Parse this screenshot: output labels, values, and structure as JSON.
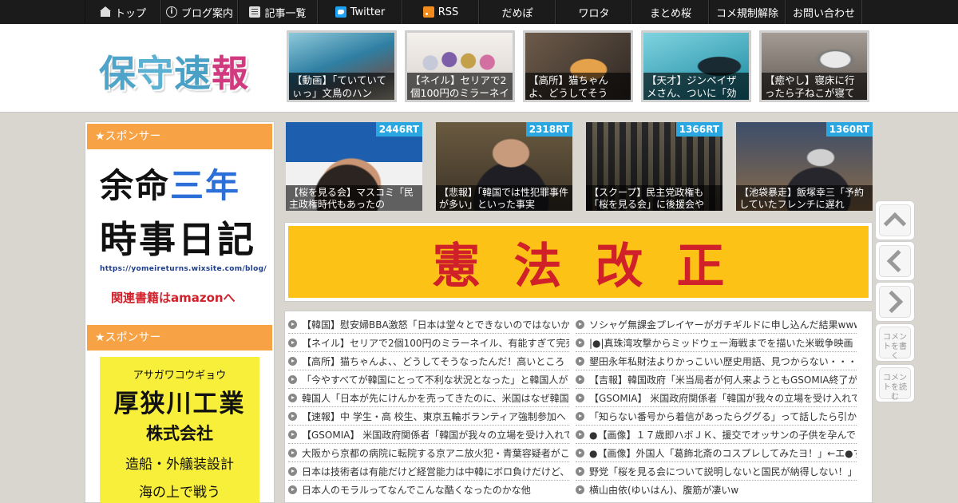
{
  "nav": {
    "items": [
      {
        "label": "トップ",
        "icon": "home-icon"
      },
      {
        "label": "ブログ案内",
        "icon": "info-icon"
      },
      {
        "label": "記事一覧",
        "icon": "list-icon"
      },
      {
        "label": "Twitter",
        "icon": "twitter-icon"
      },
      {
        "label": "RSS",
        "icon": "rss-icon"
      },
      {
        "label": "だめぽ"
      },
      {
        "label": "ワロタ"
      },
      {
        "label": "まとめ桜"
      },
      {
        "label": "コメ規制解除"
      },
      {
        "label": "お問い合わせ"
      }
    ]
  },
  "header": {
    "logo": {
      "c1": "保",
      "c2": "守",
      "c3": "速",
      "c4": "報"
    },
    "thumbs": [
      {
        "caption": "【動画】「ていていてぃっ」文鳥のハン"
      },
      {
        "caption": "【ネイル】セリアで2個100円のミラーネイ"
      },
      {
        "caption": "【高所】猫ちゃんよ、どうしてそう"
      },
      {
        "caption": "【天才】ジンベイザメさん、ついに「効"
      },
      {
        "caption": "【癒やし】寝床に行ったら子ねこが寝て"
      }
    ]
  },
  "sidebar": {
    "sponsor_label_1": "★スポンサー",
    "sponsor_label_2": "★スポンサー",
    "ad1": {
      "line1_a": "余命",
      "line1_b": "三年",
      "line2": "時事日記",
      "url": "https://yomeireturns.wixsite.com/blog/",
      "amazon": "関連書籍はamazonへ"
    },
    "ad2": {
      "kana": "アサガワコウギョウ",
      "name": "厚狭川工業",
      "company": "株式会社",
      "business": "造船・外艤装設計",
      "tagline": "海の上で戦う"
    }
  },
  "rt_thumbs": [
    {
      "count": "2446RT",
      "caption": "【桜を見る会】マスコミ「民主政権時代もあったの"
    },
    {
      "count": "2318RT",
      "caption": "【悲報】「韓国では性犯罪事件が多い」といった事実"
    },
    {
      "count": "1366RT",
      "caption": "【スクープ】民主党政権も「桜を見る会」に後援会や"
    },
    {
      "count": "1360RT",
      "caption": "【池袋暴走】飯塚幸三「予約していたフレンチに遅れ"
    }
  ],
  "banner": {
    "chars": [
      "憲",
      "法",
      "改",
      "正"
    ]
  },
  "list": {
    "left": [
      "【韓国】慰安婦BBA激怒「日本は堂々とできないのではないか",
      "【ネイル】セリアで2個100円のミラーネイル、有能すぎて完売",
      "【高所】猫ちゃんよ、、どうしてそうなったんだ！高いところ",
      "「今やすべてが韓国にとって不利な状況となった」と韓国人が",
      "韓国人「日本が先にけんかを売ってきたのに、米国はなぜ韓国",
      "【速報】中 学生・高 校生、東京五輪ボランティア強制参加へ",
      "【GSOMIA】 米国政府関係者「韓国が我々の立場を受け入れて",
      "大阪から京都の病院に転院する京アニ放火犯・青葉容疑者がこ",
      "日本は技術者は有能だけど経営能力は中韓にボロ負けだけど、",
      "日本人のモラルってなんでこんな酷くなったのかな他"
    ],
    "right": [
      "ソシャゲ無課金プレイヤーがガチギルドに申し込んだ結果www",
      "|●|真珠湾攻撃からミッドウェー海戦までを描いた米戦争映画「",
      "墾田永年私財法よりかっこいい歴史用語、見つからない・・・",
      "【吉報】韓国政府「米当局者が何人来ようともGSOMIA終了が",
      "【GSOMIA】 米国政府関係者「韓国が我々の立場を受け入れて",
      "「知らない番号から着信があったらググる」って話したら引か",
      "●【画像】１７歳即ハボＪＫ、援交でオッサンの子供を孕んで",
      "●【画像】外国人「葛飾北斎のコスプレしてみたヨ！」←エ●す",
      "野党「桜を見る会について説明しないと国民が納得しない！」",
      "横山由依(ゆいはん)、腹筋が凄いw"
    ]
  },
  "side_buttons": {
    "write_comment": "コメントを書く",
    "read_comment": "コメントを読む"
  }
}
